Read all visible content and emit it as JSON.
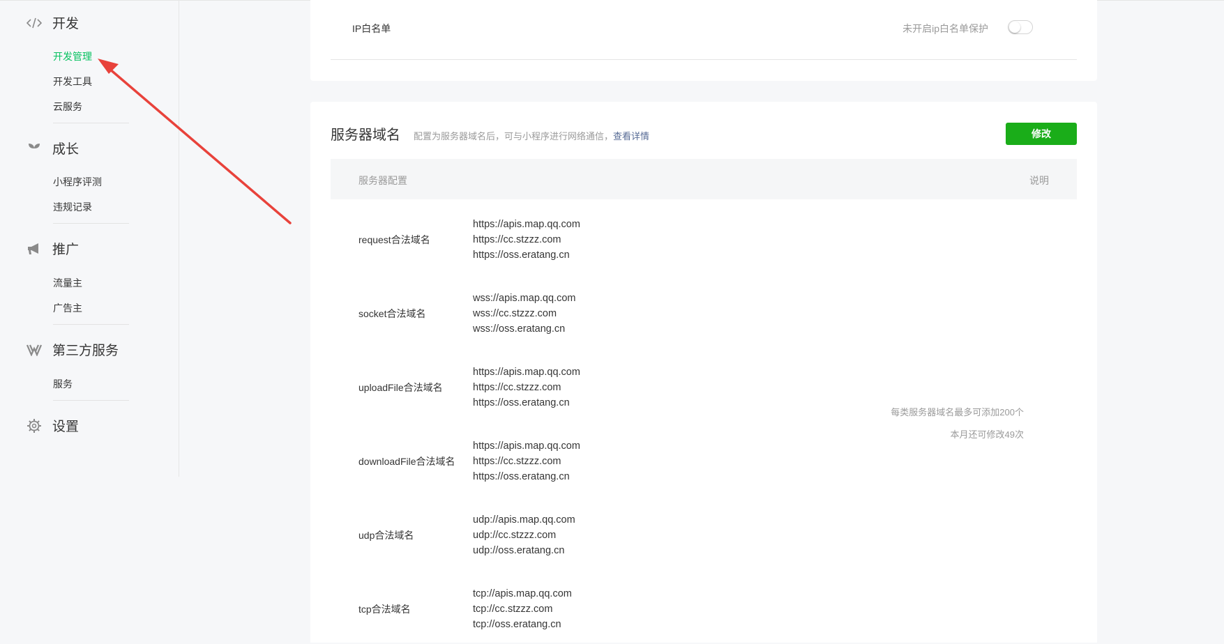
{
  "sidebar": {
    "groups": [
      {
        "icon": "code-icon",
        "title": "开发",
        "items": [
          "开发管理",
          "开发工具",
          "云服务"
        ]
      },
      {
        "icon": "sprout-icon",
        "title": "成长",
        "items": [
          "小程序评测",
          "违规记录"
        ]
      },
      {
        "icon": "megaphone-icon",
        "title": "推广",
        "items": [
          "流量主",
          "广告主"
        ]
      },
      {
        "icon": "third-party-icon",
        "title": "第三方服务",
        "items": [
          "服务"
        ]
      },
      {
        "icon": "gear-icon",
        "title": "设置",
        "items": []
      }
    ],
    "active_item": "开发管理"
  },
  "ip_whitelist": {
    "label": "IP白名单",
    "status": "未开启ip白名单保护",
    "enabled": false
  },
  "server_domain": {
    "title": "服务器域名",
    "description": "配置为服务器域名后，可与小程序进行网络通信，",
    "detail_link": "查看详情",
    "edit_button": "修改",
    "header_config": "服务器配置",
    "header_note": "说明",
    "rows": [
      {
        "name": "request合法域名",
        "values": [
          "https://apis.map.qq.com",
          "https://cc.stzzz.com",
          "https://oss.eratang.cn"
        ]
      },
      {
        "name": "socket合法域名",
        "values": [
          "wss://apis.map.qq.com",
          "wss://cc.stzzz.com",
          "wss://oss.eratang.cn"
        ]
      },
      {
        "name": "uploadFile合法域名",
        "values": [
          "https://apis.map.qq.com",
          "https://cc.stzzz.com",
          "https://oss.eratang.cn"
        ]
      },
      {
        "name": "downloadFile合法域名",
        "values": [
          "https://apis.map.qq.com",
          "https://cc.stzzz.com",
          "https://oss.eratang.cn"
        ]
      },
      {
        "name": "udp合法域名",
        "values": [
          "udp://apis.map.qq.com",
          "udp://cc.stzzz.com",
          "udp://oss.eratang.cn"
        ]
      },
      {
        "name": "tcp合法域名",
        "values": [
          "tcp://apis.map.qq.com",
          "tcp://cc.stzzz.com",
          "tcp://oss.eratang.cn"
        ]
      }
    ],
    "notes": [
      "每类服务器域名最多可添加200个",
      "本月还可修改49次"
    ]
  },
  "colors": {
    "accent_green": "#07c160",
    "button_green": "#1aad19",
    "link_blue": "#576b95",
    "annotation_arrow": "#e8423b"
  }
}
